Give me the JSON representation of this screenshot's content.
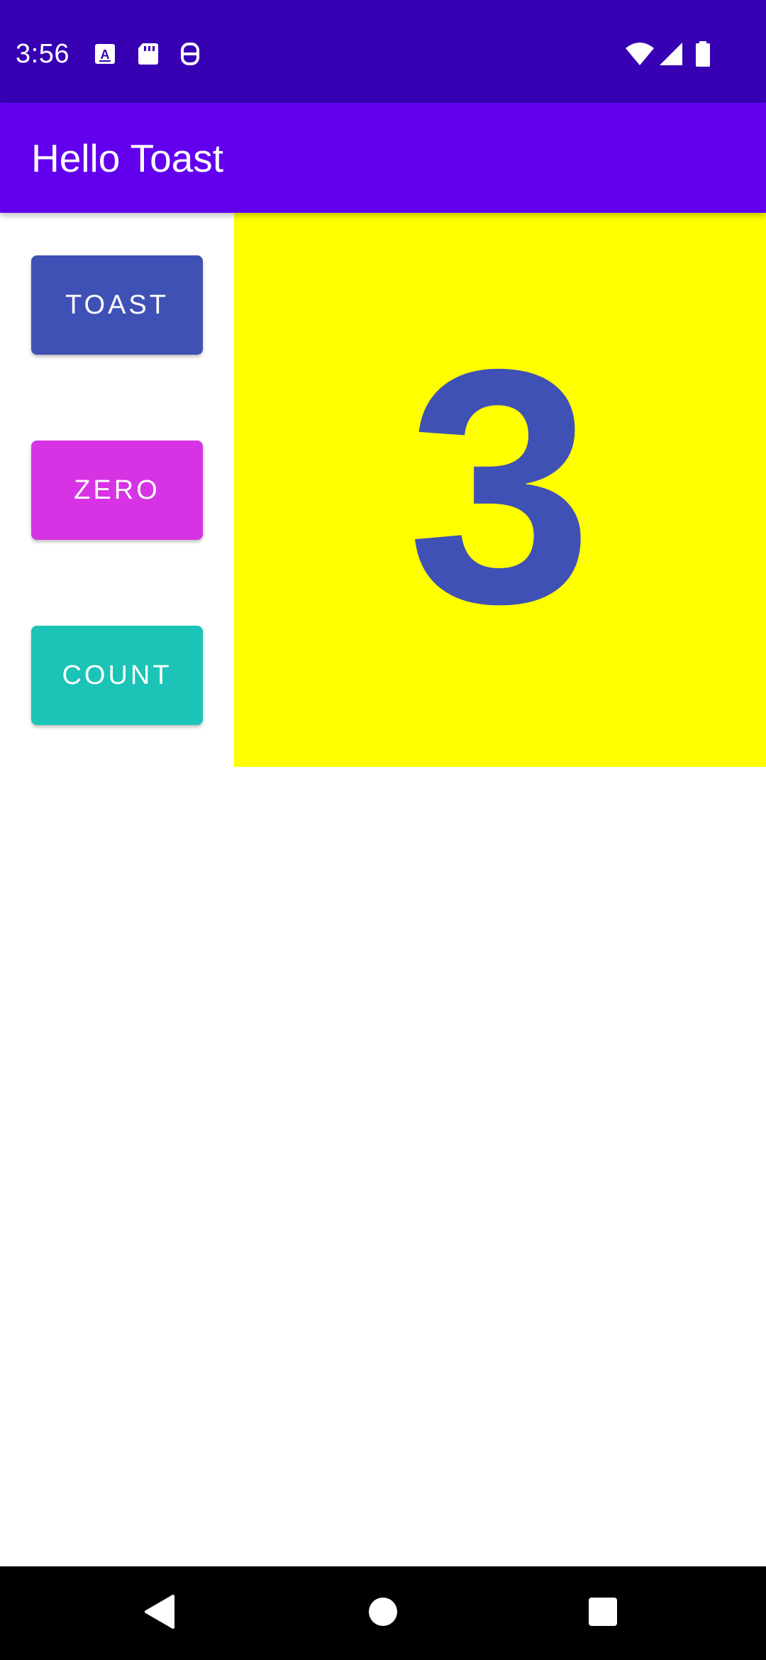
{
  "status_bar": {
    "time": "3:56",
    "left_icons": [
      "keyboard-a-icon",
      "sd-card-icon",
      "face-robot-icon"
    ],
    "right_icons": [
      "wifi-icon",
      "cell-signal-icon",
      "battery-icon"
    ]
  },
  "app_bar": {
    "title": "Hello Toast"
  },
  "buttons": {
    "toast": {
      "label": "TOAST",
      "color": "#3f51b5"
    },
    "zero": {
      "label": "ZERO",
      "color": "#d633e4"
    },
    "count": {
      "label": "COUNT",
      "color": "#1bc4b6"
    }
  },
  "counter": {
    "value": "3",
    "background": "#ffff00",
    "text_color": "#3f51b5"
  },
  "nav_bar": {
    "icons": [
      "back-icon",
      "home-icon",
      "recents-icon"
    ]
  },
  "colors": {
    "status_bar": "#3700b3",
    "app_bar": "#6200ee"
  }
}
